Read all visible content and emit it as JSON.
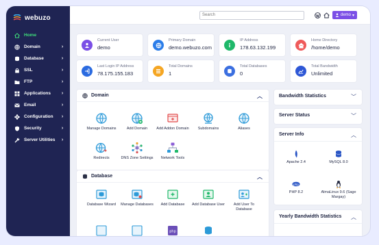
{
  "app": {
    "logo_text": "webuzo"
  },
  "search": {
    "value": "Search"
  },
  "user": {
    "label": "demo",
    "caret": "▾"
  },
  "sidebar": {
    "items": [
      {
        "label": "Home",
        "chevron": ""
      },
      {
        "label": "Domain",
        "chevron": "›"
      },
      {
        "label": "Database",
        "chevron": "›"
      },
      {
        "label": "SSL",
        "chevron": "›"
      },
      {
        "label": "FTP",
        "chevron": "›"
      },
      {
        "label": "Applications",
        "chevron": "›"
      },
      {
        "label": "Email",
        "chevron": "›"
      },
      {
        "label": "Configuration",
        "chevron": "›"
      },
      {
        "label": "Security",
        "chevron": "›"
      },
      {
        "label": "Server Utilities",
        "chevron": "›"
      }
    ]
  },
  "stats": [
    {
      "label": "Current User",
      "value": "demo",
      "color": "#7b4fe6"
    },
    {
      "label": "Primary Domain",
      "value": "demo.webuzo.com",
      "color": "#2b7de9"
    },
    {
      "label": "IP Address",
      "value": "178.63.132.199",
      "color": "#1fb86a"
    },
    {
      "label": "Home Directory",
      "value": "/home/demo",
      "color": "#ef5a5a"
    },
    {
      "label": "Last Login IP Address",
      "value": "78.175.155.183",
      "color": "#2b6be0"
    },
    {
      "label": "Total Domains",
      "value": "1",
      "color": "#f5a623"
    },
    {
      "label": "Total Databases",
      "value": "0",
      "color": "#3b6fe0"
    },
    {
      "label": "Total Bandwidth",
      "value": "Unlimited",
      "color": "#2e57d6"
    }
  ],
  "domain_panel": {
    "title": "Domain",
    "caret": "︿",
    "tiles": [
      "Manage Domains",
      "Add Domain",
      "Add Addon Domain",
      "Subdomains",
      "Aliases",
      "Redirects",
      "DNS Zone Settings",
      "Network Tools"
    ]
  },
  "database_panel": {
    "title": "Database",
    "caret": "︿",
    "tiles": [
      "Database Wizard",
      "Manage Databases",
      "Add Database",
      "Add Database User",
      "Add User To Database"
    ]
  },
  "right": {
    "bandwidth": {
      "title": "Bandwidth Statistics",
      "caret": "﹀"
    },
    "server_status": {
      "title": "Server Status",
      "caret": "﹀"
    },
    "server_info": {
      "title": "Server Info",
      "caret": "︿",
      "services": [
        "Apache 2.4",
        "MySQL 8.0",
        "PHP 8.2",
        "AlmaLinux 9.6 (Sage Margay)"
      ]
    },
    "yearly": {
      "title": "Yearly Bandwidth Statistics",
      "caret": "︿"
    }
  }
}
